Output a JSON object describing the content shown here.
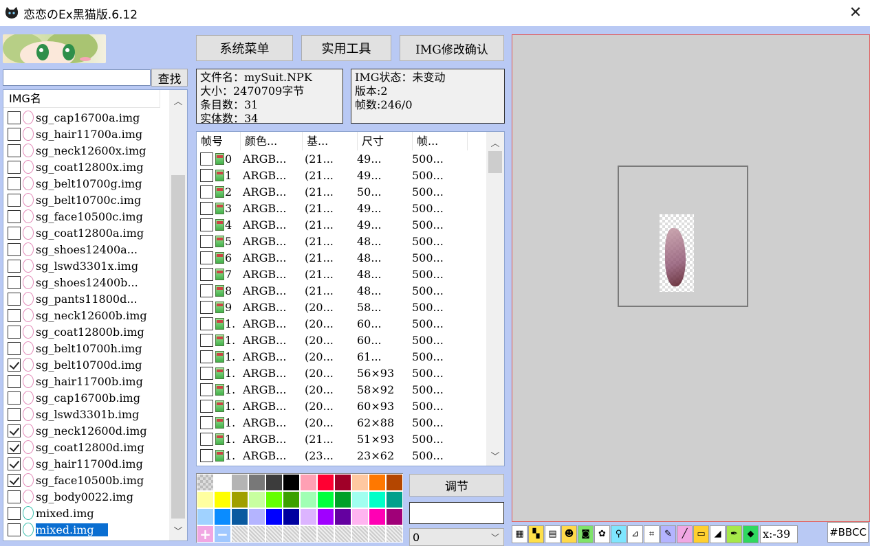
{
  "window": {
    "title": "恋恋のEx黑猫版.6.12"
  },
  "search": {
    "value": "",
    "button": "查找"
  },
  "img_list": {
    "header": "IMG名",
    "items": [
      {
        "name": "sg_cap16700a.img",
        "checked": false
      },
      {
        "name": "sg_hair11700a.img",
        "checked": false
      },
      {
        "name": "sg_neck12600x.img",
        "checked": false
      },
      {
        "name": "sg_coat12800x.img",
        "checked": false
      },
      {
        "name": "sg_belt10700g.img",
        "checked": false
      },
      {
        "name": "sg_belt10700c.img",
        "checked": false
      },
      {
        "name": "sg_face10500c.img",
        "checked": false
      },
      {
        "name": "sg_coat12800a.img",
        "checked": false
      },
      {
        "name": "sg_shoes12400a...",
        "checked": false
      },
      {
        "name": "sg_lswd3301x.img",
        "checked": false
      },
      {
        "name": "sg_shoes12400b...",
        "checked": false
      },
      {
        "name": "sg_pants11800d...",
        "checked": false
      },
      {
        "name": "sg_neck12600b.img",
        "checked": false
      },
      {
        "name": "sg_coat12800b.img",
        "checked": false
      },
      {
        "name": "sg_belt10700h.img",
        "checked": false
      },
      {
        "name": "sg_belt10700d.img",
        "checked": true
      },
      {
        "name": "sg_hair11700b.img",
        "checked": false
      },
      {
        "name": "sg_cap16700b.img",
        "checked": false
      },
      {
        "name": "sg_lswd3301b.img",
        "checked": false
      },
      {
        "name": "sg_neck12600d.img",
        "checked": true
      },
      {
        "name": "sg_coat12800d.img",
        "checked": true
      },
      {
        "name": "sg_hair11700d.img",
        "checked": true
      },
      {
        "name": "sg_face10500b.img",
        "checked": true
      },
      {
        "name": "sg_body0022.img",
        "checked": false
      },
      {
        "name": "mixed.img",
        "checked": false,
        "icon": "teal"
      },
      {
        "name": "mixed.img",
        "checked": false,
        "icon": "teal",
        "selected": true
      }
    ]
  },
  "toolbar_buttons": {
    "system_menu": "系统菜单",
    "tools": "实用工具",
    "img_confirm": "IMG修改确认"
  },
  "file_info": {
    "line1": "文件名：mySuit.NPK",
    "line2": "大小：2470709字节",
    "line3": "条目数：31",
    "line4": "实体数：34"
  },
  "img_info": {
    "line1": "IMG状态：未变动",
    "line2": "版本:2",
    "line3": "帧数:246/0"
  },
  "frame_table": {
    "headers": [
      "帧号",
      "颜色...",
      "基...",
      "尺寸",
      "帧..."
    ],
    "rows": [
      [
        "0",
        "ARGB...",
        "(21...",
        "49...",
        "500..."
      ],
      [
        "1",
        "ARGB...",
        "(21...",
        "49...",
        "500..."
      ],
      [
        "2",
        "ARGB...",
        "(21...",
        "50...",
        "500..."
      ],
      [
        "3",
        "ARGB...",
        "(21...",
        "49...",
        "500..."
      ],
      [
        "4",
        "ARGB...",
        "(21...",
        "49...",
        "500..."
      ],
      [
        "5",
        "ARGB...",
        "(21...",
        "48...",
        "500..."
      ],
      [
        "6",
        "ARGB...",
        "(21...",
        "48...",
        "500..."
      ],
      [
        "7",
        "ARGB...",
        "(21...",
        "48...",
        "500..."
      ],
      [
        "8",
        "ARGB...",
        "(21...",
        "48...",
        "500..."
      ],
      [
        "9",
        "ARGB...",
        "(20...",
        "58...",
        "500..."
      ],
      [
        "1.",
        "ARGB...",
        "(20...",
        "60...",
        "500..."
      ],
      [
        "1.",
        "ARGB...",
        "(20...",
        "60...",
        "500..."
      ],
      [
        "1.",
        "ARGB...",
        "(20...",
        "61...",
        "500..."
      ],
      [
        "1.",
        "ARGB...",
        "(20...",
        "56×93",
        "500..."
      ],
      [
        "1.",
        "ARGB...",
        "(20...",
        "58×92",
        "500..."
      ],
      [
        "1.",
        "ARGB...",
        "(20...",
        "60×93",
        "500..."
      ],
      [
        "1.",
        "ARGB...",
        "(20...",
        "62×88",
        "500..."
      ],
      [
        "1.",
        "ARGB...",
        "(21...",
        "51×93",
        "500..."
      ],
      [
        "1.",
        "ARGB...",
        "(23...",
        "23×62",
        "500..."
      ]
    ]
  },
  "palette": {
    "row1": [
      "checker",
      "#ffffff",
      "#b4b4b4",
      "#787878",
      "#3c3c3c",
      "#000000",
      "#ffa0b4",
      "#ff0032",
      "#a00028",
      "#ffc8a0",
      "#ff7800",
      "#b44600"
    ],
    "row2": [
      "#ffffa0",
      "#ffff00",
      "#a0a000",
      "#c8ffa0",
      "#64ff00",
      "#3ca000",
      "#a0ffb4",
      "#00ff3c",
      "#00a028",
      "#a0fff0",
      "#00ffc8",
      "#00a08c"
    ],
    "row3": [
      "#a0d2ff",
      "#0a8cff",
      "#0a5aa0",
      "#b4b4ff",
      "#0000ff",
      "#0000a0",
      "#dcb4ff",
      "#a000ff",
      "#6400a0",
      "#ffb4f0",
      "#ff00b4",
      "#a00078"
    ],
    "row4": [
      "plus",
      "minus",
      "hatch",
      "hatch",
      "hatch",
      "hatch",
      "hatch",
      "hatch",
      "hatch",
      "hatch",
      "hatch",
      "hatch"
    ]
  },
  "adjust": {
    "label": "调节",
    "color_value": "",
    "mode": "0"
  },
  "status": {
    "coord": "x:-39",
    "color": "#BBCC"
  },
  "tools": [
    "layers-icon",
    "grid-icon",
    "film-icon",
    "cat-icon",
    "camera-icon",
    "paw-icon",
    "zoom-icon",
    "measure-icon",
    "crop-icon",
    "pen-icon",
    "line-icon",
    "rect-icon",
    "eraser-icon",
    "eyedropper-icon",
    "tag-icon"
  ],
  "colors": {
    "accent": "#0a6ed1",
    "panel": "#b9c9f4",
    "canvas": "#cfcfcf"
  }
}
